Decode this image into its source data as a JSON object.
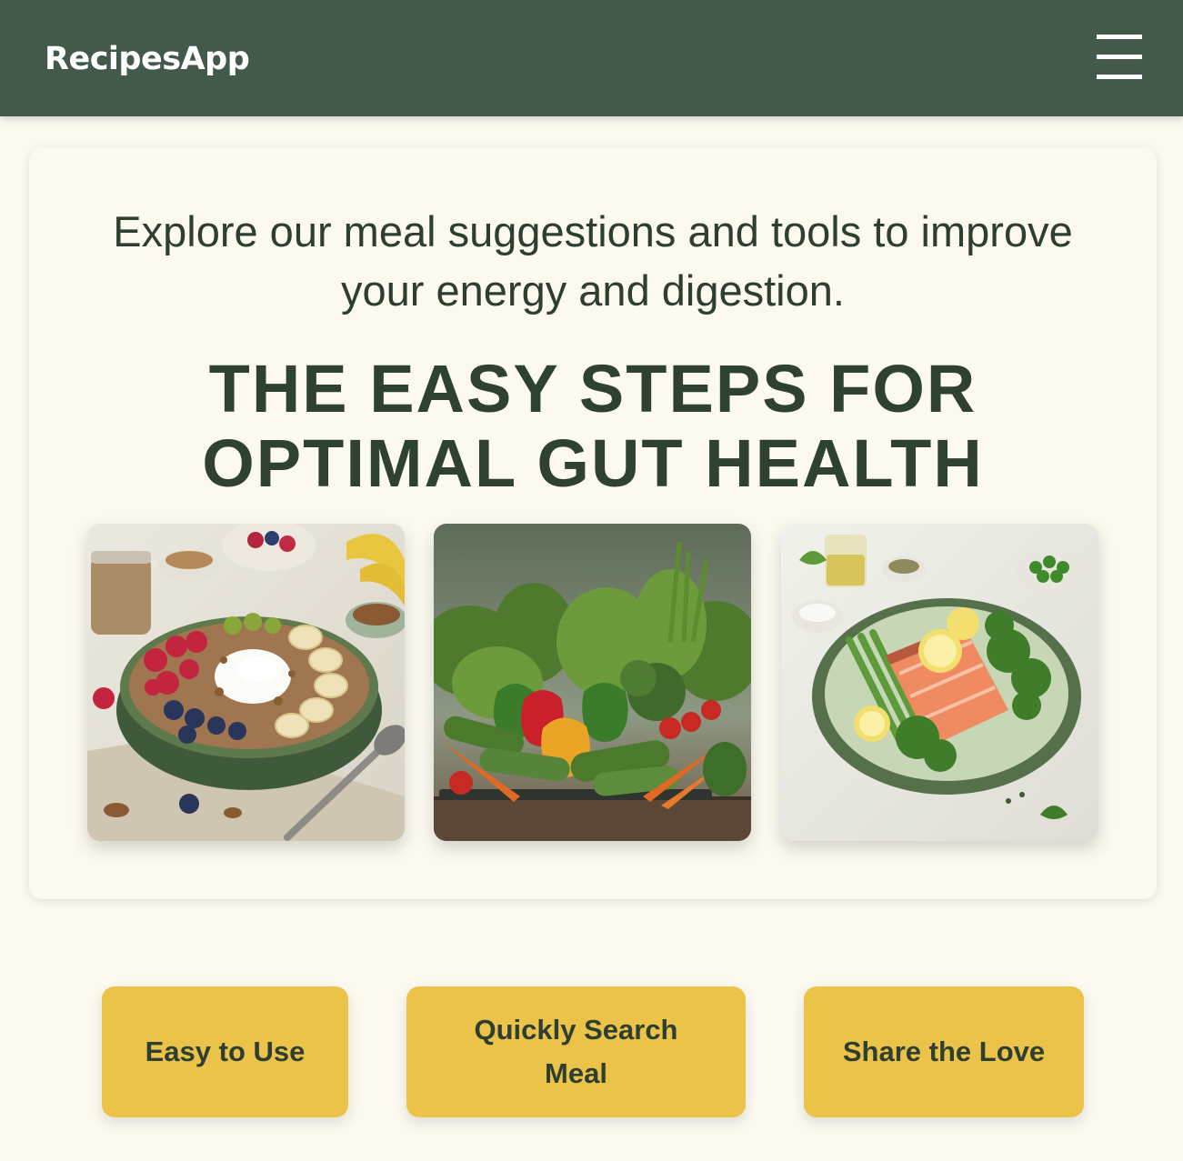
{
  "header": {
    "brand": "RecipesApp",
    "menu_icon": "hamburger-menu-icon"
  },
  "hero": {
    "intro": "Explore our meal suggestions and tools to improve your energy and digestion.",
    "title": "THE EASY STEPS FOR OPTIMAL GUT HEALTH",
    "images": [
      {
        "subject": "yogurt bowl with berries, banana, granola and nuts"
      },
      {
        "subject": "assorted fresh vegetables on a wooden table"
      },
      {
        "subject": "salmon fillet with asparagus, broccoli and lemon"
      }
    ]
  },
  "features": [
    {
      "label": "Easy to Use"
    },
    {
      "label": "Quickly Search Meal"
    },
    {
      "label": "Share the Love"
    }
  ],
  "colors": {
    "header_bg": "#435a4a",
    "page_bg": "#fcfaf0",
    "button_bg": "#ecc349",
    "text_dark": "#2e3e31"
  }
}
